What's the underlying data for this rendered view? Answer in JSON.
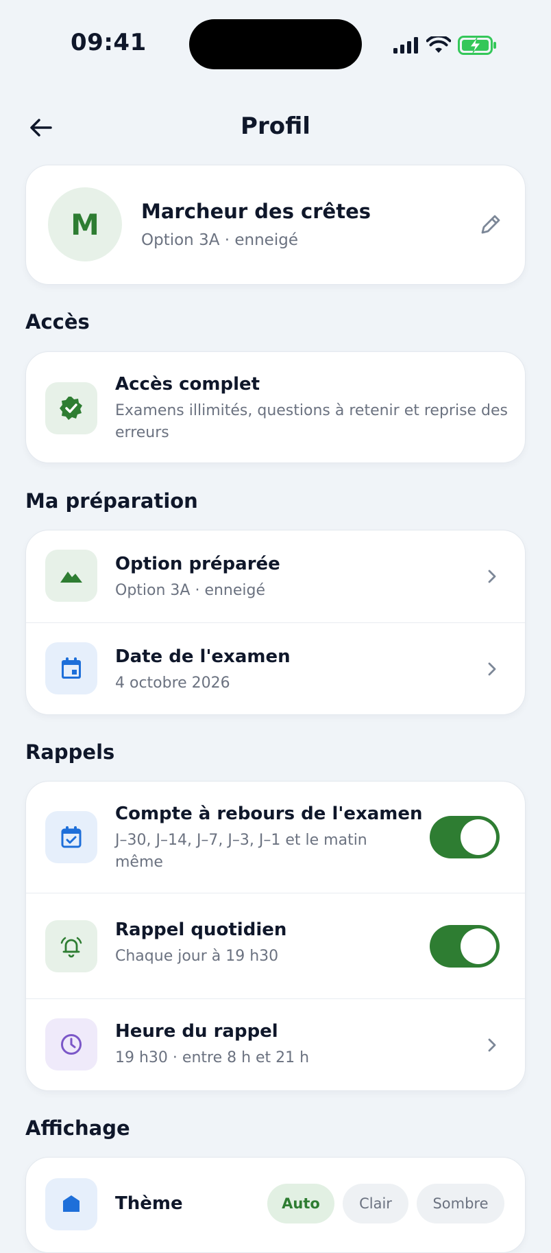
{
  "status": {
    "time": "09:41"
  },
  "nav": {
    "title": "Profil"
  },
  "profile": {
    "initial": "M",
    "name": "Marcheur des crêtes",
    "subtitle": "Option 3A · enneigé"
  },
  "access": {
    "section_title": "Accès",
    "title": "Accès complet",
    "description_line1": "Examens illimités, questions à retenir et reprise des",
    "description_line2": "erreurs"
  },
  "preparation": {
    "section_title": "Ma préparation",
    "items": [
      {
        "title": "Option préparée",
        "subtitle": "Option 3A · enneigé"
      },
      {
        "title": "Date de l'examen",
        "subtitle": "4 octobre 2026"
      }
    ]
  },
  "reminders": {
    "section_title": "Rappels",
    "countdown": {
      "title": "Compte à rebours de l'examen",
      "subtitle_line1": "J–30, J–14, J–7, J–3, J–1 et le matin",
      "subtitle_line2": "même",
      "enabled": true
    },
    "daily": {
      "title": "Rappel quotidien",
      "subtitle": "Chaque jour à 19 h30",
      "enabled": true
    },
    "time": {
      "title": "Heure du rappel",
      "subtitle": "19 h30 · entre 8 h et 21 h"
    }
  },
  "display": {
    "section_title": "Affichage",
    "theme_title": "Thème",
    "options": [
      "Auto",
      "Clair",
      "Sombre"
    ]
  },
  "colors": {
    "accent": "#2E7D32",
    "background": "#F0F4F8",
    "blue_icon": "#1E6FD9",
    "purple_icon": "#7B57C8"
  }
}
